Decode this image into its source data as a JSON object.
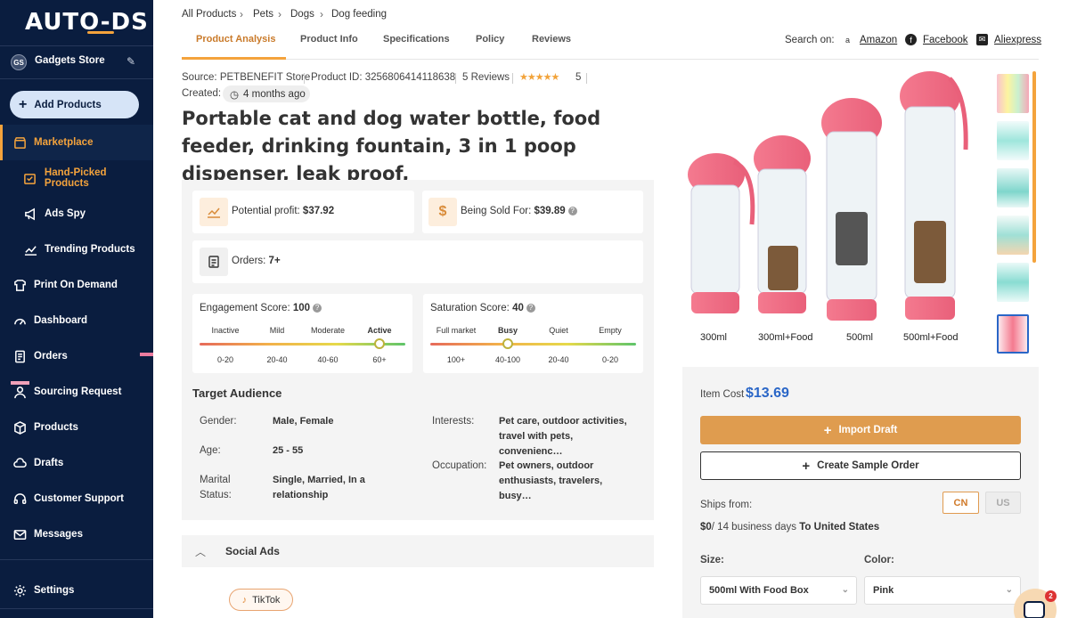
{
  "brand": {
    "logo": "AUTO-DS"
  },
  "store": {
    "initials": "GS",
    "name": "Gadgets Store"
  },
  "sidebar": {
    "add_products": "Add Products",
    "items": [
      {
        "label": "Marketplace",
        "icon": "store-icon"
      },
      {
        "label": "Hand-Picked Products",
        "icon": "hand-picked-icon"
      },
      {
        "label": "Ads Spy",
        "icon": "megaphone-icon"
      },
      {
        "label": "Trending Products",
        "icon": "trending-icon"
      },
      {
        "label": "Print On Demand",
        "icon": "print-icon"
      },
      {
        "label": "Dashboard",
        "icon": "dashboard-icon"
      },
      {
        "label": "Orders",
        "icon": "orders-icon"
      },
      {
        "label": "Sourcing Request",
        "icon": "sourcing-icon"
      },
      {
        "label": "Products",
        "icon": "box-icon"
      },
      {
        "label": "Drafts",
        "icon": "drafts-icon"
      },
      {
        "label": "Customer Support",
        "icon": "support-icon"
      },
      {
        "label": "Messages",
        "icon": "mail-icon"
      },
      {
        "label": "Settings",
        "icon": "gear-icon"
      }
    ]
  },
  "breadcrumb": [
    "All Products",
    "Pets",
    "Dogs",
    "Dog feeding"
  ],
  "tabs": [
    "Product Analysis",
    "Product Info",
    "Specifications",
    "Policy",
    "Reviews"
  ],
  "search_on": {
    "label": "Search on:",
    "sites": [
      "Amazon",
      "Facebook",
      "Aliexpress"
    ]
  },
  "product": {
    "source": "Source: PETBENEFIT Store",
    "product_id": "Product ID: 3256806414118638",
    "reviews": "5 Reviews",
    "rating": "5",
    "created_label": "Created:",
    "created_value": "4 months ago",
    "title": "Portable cat and dog water bottle, food feeder, drinking fountain, 3 in 1 poop dispenser, leak proof,"
  },
  "stats": {
    "profit_label": "Potential profit:",
    "profit_value": "$37.92",
    "sold_label": "Being Sold For:",
    "sold_value": "$39.89",
    "orders_label": "Orders:",
    "orders_value": "7+"
  },
  "engagement": {
    "title": "Engagement Score:",
    "score": "100",
    "level": 1.0,
    "labels": [
      "Inactive",
      "Mild",
      "Moderate",
      "Active"
    ],
    "ticks": [
      "0-20",
      "20-40",
      "40-60",
      "60+"
    ]
  },
  "saturation": {
    "title": "Saturation Score:",
    "score": "40",
    "level": 0.4,
    "labels": [
      "Full market",
      "Busy",
      "Quiet",
      "Empty"
    ],
    "ticks": [
      "100+",
      "40-100",
      "20-40",
      "0-20"
    ]
  },
  "audience": {
    "title": "Target Audience",
    "gender_label": "Gender:",
    "gender_value": "Male, Female",
    "age_label": "Age:",
    "age_value": "25 - 55",
    "marital_label": "Marital Status:",
    "marital_value": "Single, Married, In a relationship",
    "interests_label": "Interests:",
    "interests_value": "Pet care, outdoor activities, travel with pets, convenienc…",
    "occupation_label": "Occupation:",
    "occupation_value": "Pet owners, outdoor enthusiasts, travelers, busy…"
  },
  "social": {
    "title": "Social Ads",
    "tiktok": "TikTok"
  },
  "image_labels": [
    "300ml",
    "300ml+Food",
    "500ml",
    "500ml+Food"
  ],
  "pricing": {
    "item_cost_label": "Item Cost",
    "item_cost": "$13.69"
  },
  "actions": {
    "import_draft": "Import Draft",
    "create_sample": "Create Sample Order"
  },
  "shipping": {
    "ships_from": "Ships from:",
    "cn": "CN",
    "us": "US",
    "cost": "$0",
    "days": "/ 14 business days",
    "destination": "To United States"
  },
  "variants": {
    "size_label": "Size:",
    "size_value": "500ml With Food Box",
    "color_label": "Color:",
    "color_value": "Pink"
  },
  "chat": {
    "badge": "2"
  },
  "colors": {
    "sidebar": "#0a1d3f",
    "accent": "#f4a33c",
    "price": "#2a66c7",
    "import": "#df9c4f"
  }
}
